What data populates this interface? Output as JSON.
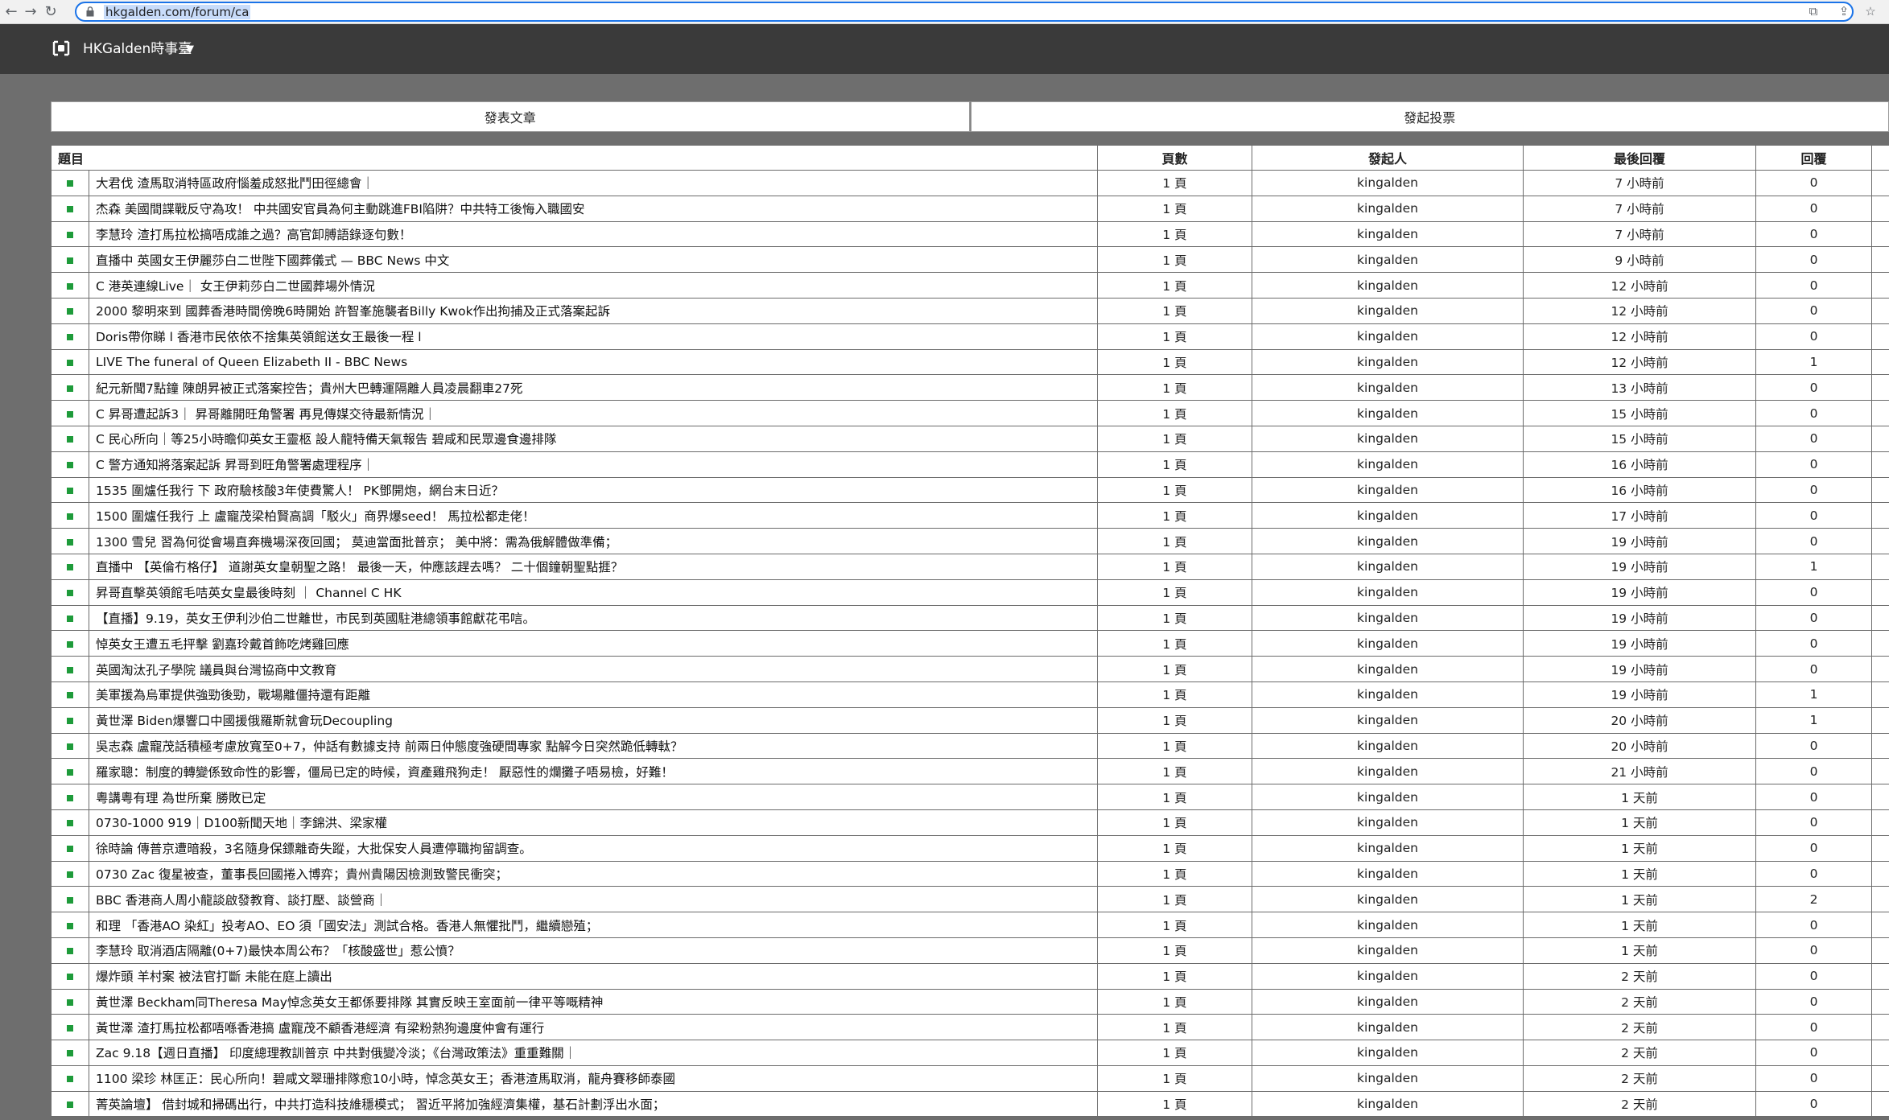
{
  "browser": {
    "url": "hkgalden.com/forum/ca"
  },
  "header": {
    "title": "HKGalden時事臺"
  },
  "actions": {
    "post_label": "發表文章",
    "poll_label": "發起投票"
  },
  "table": {
    "columns": [
      "題目",
      "頁數",
      "發起人",
      "最後回覆",
      "回覆"
    ],
    "rows": [
      {
        "title": "大君伐 渣馬取消特區政府惱羞成怒批鬥田徑總會｜",
        "pages": "1 頁",
        "author": "kingalden",
        "last": "7 小時前",
        "replies": "0"
      },
      {
        "title": "杰森 美國間諜戰反守為攻！ 中共國安官員為何主動跳進FBI陷阱？中共特工後悔入職國安",
        "pages": "1 頁",
        "author": "kingalden",
        "last": "7 小時前",
        "replies": "0"
      },
      {
        "title": "李慧玲 渣打馬拉松搞唔成誰之過？高官卸膊語錄逐句數！",
        "pages": "1 頁",
        "author": "kingalden",
        "last": "7 小時前",
        "replies": "0"
      },
      {
        "title": "直播中 英國女王伊麗莎白二世陛下國葬儀式 — BBC News 中文",
        "pages": "1 頁",
        "author": "kingalden",
        "last": "9 小時前",
        "replies": "0"
      },
      {
        "title": "C 港英連線Live｜ 女王伊莉莎白二世國葬場外情況",
        "pages": "1 頁",
        "author": "kingalden",
        "last": "12 小時前",
        "replies": "0"
      },
      {
        "title": "2000 黎明來到 國葬香港時間傍晚6時開始 許智峯施襲者Billy Kwok作出拘捕及正式落案起訴",
        "pages": "1 頁",
        "author": "kingalden",
        "last": "12 小時前",
        "replies": "0"
      },
      {
        "title": "Doris帶你睇 l 香港市民依依不捨集英領館送女王最後一程 l",
        "pages": "1 頁",
        "author": "kingalden",
        "last": "12 小時前",
        "replies": "0"
      },
      {
        "title": "LIVE The funeral of Queen Elizabeth II - BBC News",
        "pages": "1 頁",
        "author": "kingalden",
        "last": "12 小時前",
        "replies": "1"
      },
      {
        "title": "紀元新聞7點鐘 陳朗昇被正式落案控告；貴州大巴轉運隔離人員凌晨翻車27死",
        "pages": "1 頁",
        "author": "kingalden",
        "last": "13 小時前",
        "replies": "0"
      },
      {
        "title": "C 昇哥遭起訴3｜ 昇哥離開旺角警署 再見傳媒交待最新情況｜",
        "pages": "1 頁",
        "author": "kingalden",
        "last": "15 小時前",
        "replies": "0"
      },
      {
        "title": "C 民心所向｜等25小時瞻仰英女王靈柩 設人龍特備天氣報告 碧咸和民眾邊食邊排隊",
        "pages": "1 頁",
        "author": "kingalden",
        "last": "15 小時前",
        "replies": "0"
      },
      {
        "title": "C 警方通知將落案起訴 昇哥到旺角警署處理程序｜",
        "pages": "1 頁",
        "author": "kingalden",
        "last": "16 小時前",
        "replies": "0"
      },
      {
        "title": "1535 圍爐任我行 下 政府驗核酸3年使費驚人！ PK鄧開炮，網台末日近？",
        "pages": "1 頁",
        "author": "kingalden",
        "last": "16 小時前",
        "replies": "0"
      },
      {
        "title": "1500 圍爐任我行 上 盧寵茂梁柏賢高調「駁火」商界爆seed！ 馬拉松都走佬！",
        "pages": "1 頁",
        "author": "kingalden",
        "last": "17 小時前",
        "replies": "0"
      },
      {
        "title": "1300 雪兒 習為何從會場直奔機場深夜回國； 莫迪當面批普京； 美中將：需為俄解體做準備；",
        "pages": "1 頁",
        "author": "kingalden",
        "last": "19 小時前",
        "replies": "0"
      },
      {
        "title": "直播中 【英倫冇格仔】 道謝英女皇朝聖之路！ 最後一天，仲應該趕去嗎？ 二十個鐘朝聖點捱？",
        "pages": "1 頁",
        "author": "kingalden",
        "last": "19 小時前",
        "replies": "1"
      },
      {
        "title": "昇哥直擊英領館毛咭英女皇最後時刻 ｜ Channel C HK",
        "pages": "1 頁",
        "author": "kingalden",
        "last": "19 小時前",
        "replies": "0"
      },
      {
        "title": "【直播】9.19，英女王伊利沙伯二世離世，市民到英國駐港總領事館獻花弔唁。",
        "pages": "1 頁",
        "author": "kingalden",
        "last": "19 小時前",
        "replies": "0"
      },
      {
        "title": "悼英女王遭五毛抨擊 劉嘉玲戴首飾吃烤雞回應",
        "pages": "1 頁",
        "author": "kingalden",
        "last": "19 小時前",
        "replies": "0"
      },
      {
        "title": "英國淘汰孔子學院 議員與台灣協商中文教育",
        "pages": "1 頁",
        "author": "kingalden",
        "last": "19 小時前",
        "replies": "0"
      },
      {
        "title": "美軍援為烏軍提供強勁後勁，戰場離僵持還有距離",
        "pages": "1 頁",
        "author": "kingalden",
        "last": "19 小時前",
        "replies": "1"
      },
      {
        "title": "黃世澤 Biden爆響口中國援俄羅斯就會玩Decoupling",
        "pages": "1 頁",
        "author": "kingalden",
        "last": "20 小時前",
        "replies": "1"
      },
      {
        "title": "吳志森 盧寵茂話積極考慮放寬至0+7，仲話有數據支持 前兩日仲態度強硬間專家 點解今日突然跪低轉軚？",
        "pages": "1 頁",
        "author": "kingalden",
        "last": "20 小時前",
        "replies": "0"
      },
      {
        "title": "羅家聰：制度的轉變係致命性的影響，僵局已定的時候，資產雞飛狗走！ 厭惡性的爛攤子唔易檢，好難！",
        "pages": "1 頁",
        "author": "kingalden",
        "last": "21 小時前",
        "replies": "0"
      },
      {
        "title": "粵講粵有理 為世所棄 勝敗已定",
        "pages": "1 頁",
        "author": "kingalden",
        "last": "1 天前",
        "replies": "0"
      },
      {
        "title": "0730-1000 919｜D100新聞天地｜李錦洪、梁家權",
        "pages": "1 頁",
        "author": "kingalden",
        "last": "1 天前",
        "replies": "0"
      },
      {
        "title": "徐時論 傳普京遭暗殺，3名隨身保鏢離奇失蹤，大批保安人員遭停職拘留調查。",
        "pages": "1 頁",
        "author": "kingalden",
        "last": "1 天前",
        "replies": "0"
      },
      {
        "title": "0730 Zac 復星被查，董事長回國捲入博弈；貴州貴陽因檢測致警民衝突；",
        "pages": "1 頁",
        "author": "kingalden",
        "last": "1 天前",
        "replies": "0"
      },
      {
        "title": "BBC 香港商人周小龍談啟發教育、談打壓、談營商｜",
        "pages": "1 頁",
        "author": "kingalden",
        "last": "1 天前",
        "replies": "2"
      },
      {
        "title": "和理 「香港AO 染紅」投考AO、EO 須「國安法」測試合格。香港人無懼批鬥，繼續戀殖；",
        "pages": "1 頁",
        "author": "kingalden",
        "last": "1 天前",
        "replies": "0"
      },
      {
        "title": "李慧玲 取消酒店隔離(0+7)最快本周公布？「核酸盛世」惹公憤？",
        "pages": "1 頁",
        "author": "kingalden",
        "last": "1 天前",
        "replies": "0"
      },
      {
        "title": "爆炸頭 羊村案 被法官打斷 未能在庭上讀出",
        "pages": "1 頁",
        "author": "kingalden",
        "last": "2 天前",
        "replies": "0"
      },
      {
        "title": "黃世澤 Beckham同Theresa May悼念英女王都係要排隊 其實反映王室面前一律平等嘅精神",
        "pages": "1 頁",
        "author": "kingalden",
        "last": "2 天前",
        "replies": "0"
      },
      {
        "title": "黃世澤 渣打馬拉松都唔喺香港搞 盧寵茂不顧香港經濟 有梁粉熱狗邊度仲會有運行",
        "pages": "1 頁",
        "author": "kingalden",
        "last": "2 天前",
        "replies": "0"
      },
      {
        "title": "Zac 9.18【週日直播】 印度總理教訓普京 中共對俄變冷淡；《台灣政策法》重重難關｜",
        "pages": "1 頁",
        "author": "kingalden",
        "last": "2 天前",
        "replies": "0"
      },
      {
        "title": "1100 梁珍 林匡正：民心所向！碧咸文翠珊排隊愈10小時，悼念英女王；香港渣馬取消，龍舟賽移師泰國",
        "pages": "1 頁",
        "author": "kingalden",
        "last": "2 天前",
        "replies": "0"
      },
      {
        "title": "菁英論壇】 借封城和掃碼出行，中共打造科技維穩模式； 習近平將加強經濟集權，基石計劃浮出水面；",
        "pages": "1 頁",
        "author": "kingalden",
        "last": "2 天前",
        "replies": "0"
      }
    ]
  }
}
